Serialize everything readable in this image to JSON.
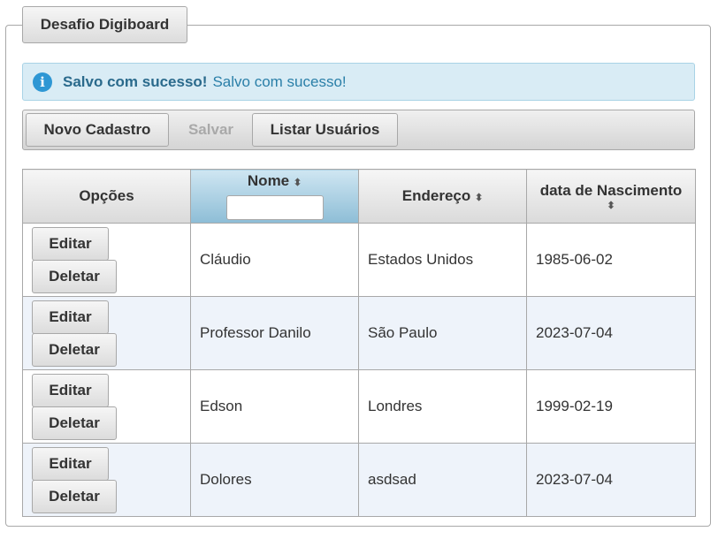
{
  "panel": {
    "legend": "Desafio Digiboard"
  },
  "message": {
    "icon": "info-icon",
    "summary": "Salvo com sucesso!",
    "detail": "Salvo com sucesso!"
  },
  "toolbar": {
    "new_label": "Novo Cadastro",
    "save_label": "Salvar",
    "list_label": "Listar Usuários"
  },
  "table": {
    "headers": {
      "options": "Opções",
      "name": "Nome",
      "address": "Endereço",
      "birth": "data de Nascimento",
      "sort_glyph": "⬍"
    },
    "edit_label": "Editar",
    "delete_label": "Deletar",
    "rows": [
      {
        "name": "Cláudio",
        "address": "Estados Unidos",
        "birth": "1985-06-02"
      },
      {
        "name": "Professor Danilo",
        "address": "São Paulo",
        "birth": "2023-07-04"
      },
      {
        "name": "Edson",
        "address": "Londres",
        "birth": "1999-02-19"
      },
      {
        "name": "Dolores",
        "address": "asdsad",
        "birth": "2023-07-04"
      }
    ]
  },
  "colors": {
    "accent": "#2e97d4",
    "message_bg": "#d9ecf5",
    "sorted_header": "#8dbdd6",
    "alt_row": "#eef3fa"
  }
}
